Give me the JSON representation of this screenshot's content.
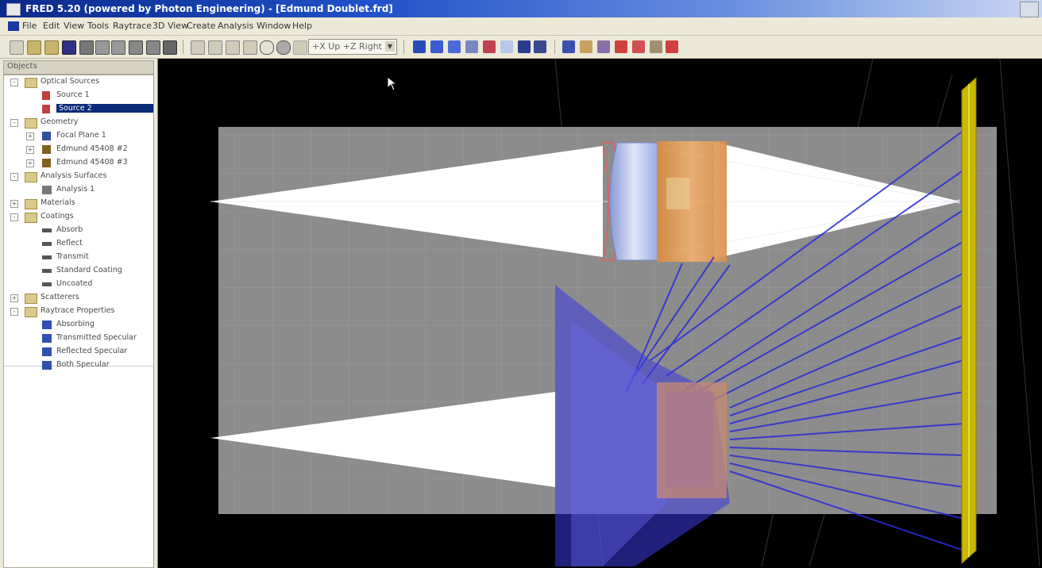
{
  "window": {
    "title": "FRED 5.20 (powered by Photon Engineering) - [Edmund Doublet.frd]"
  },
  "menu": [
    "File",
    "Edit",
    "View",
    "Tools",
    "Raytrace",
    "3D View",
    "Create",
    "Analysis",
    "Window",
    "Help"
  ],
  "toolbar": {
    "view_select": "+X Up +Z Right"
  },
  "tree": {
    "header": "Objects",
    "nodes": [
      {
        "label": "Optical Sources",
        "level": 0,
        "icon": "folder-icon",
        "expand": "-"
      },
      {
        "label": "Source 1",
        "level": 1,
        "icon": "source-icon"
      },
      {
        "label": "Source 2",
        "level": 1,
        "icon": "source-icon",
        "selected": true
      },
      {
        "label": "Geometry",
        "level": 0,
        "icon": "folder-icon",
        "expand": "-"
      },
      {
        "label": "Focal Plane 1",
        "level": 1,
        "icon": "surface-icon",
        "expand": "+"
      },
      {
        "label": "Edmund 45408 #2",
        "level": 1,
        "icon": "lens-icon",
        "expand": "+"
      },
      {
        "label": "Edmund 45408 #3",
        "level": 1,
        "icon": "lens-icon",
        "expand": "+"
      },
      {
        "label": "Analysis Surfaces",
        "level": 0,
        "icon": "folder-icon",
        "expand": "-"
      },
      {
        "label": "Analysis 1",
        "level": 1,
        "icon": "analysis-icon"
      },
      {
        "label": "Materials",
        "level": 0,
        "icon": "folder-icon",
        "expand": "+"
      },
      {
        "label": "Coatings",
        "level": 0,
        "icon": "folder-icon",
        "expand": "-"
      },
      {
        "label": "Absorb",
        "level": 1,
        "icon": "coating-icon"
      },
      {
        "label": "Reflect",
        "level": 1,
        "icon": "coating-icon"
      },
      {
        "label": "Transmit",
        "level": 1,
        "icon": "coating-icon"
      },
      {
        "label": "Standard Coating",
        "level": 1,
        "icon": "coating-icon"
      },
      {
        "label": "Uncoated",
        "level": 1,
        "icon": "coating-icon"
      },
      {
        "label": "Scatterers",
        "level": 0,
        "icon": "folder-icon",
        "expand": "+"
      },
      {
        "label": "Raytrace Properties",
        "level": 0,
        "icon": "folder-icon",
        "expand": "-"
      },
      {
        "label": "Absorbing",
        "level": 1,
        "icon": "raytrace-icon"
      },
      {
        "label": "Transmitted Specular",
        "level": 1,
        "icon": "raytrace-icon"
      },
      {
        "label": "Reflected Specular",
        "level": 1,
        "icon": "raytrace-icon"
      },
      {
        "label": "Both Specular",
        "level": 1,
        "icon": "raytrace-icon"
      }
    ]
  },
  "colors": {
    "grid_plane": "#8c8c8c",
    "ray_white": "#ffffff",
    "ray_blue": "#2a2ad8",
    "lens_orange": "#e8a060",
    "lens_blue": "#aabbe8",
    "focal_plane": "#c8b800",
    "selection": "#0a2a78"
  }
}
